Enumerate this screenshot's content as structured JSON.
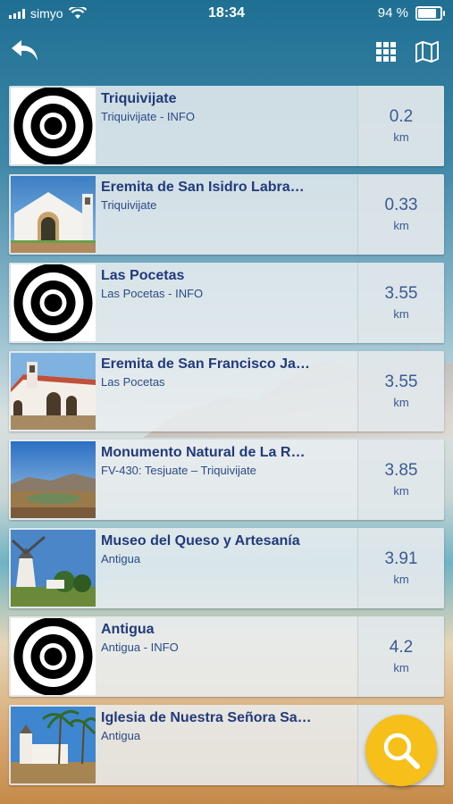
{
  "status": {
    "carrier": "simyo",
    "time": "18:34",
    "battery": "94 %",
    "battery_level": 0.94
  },
  "toolbar": {
    "back_icon": "back-arrow-icon",
    "grid_icon": "grid-icon",
    "map_icon": "map-icon"
  },
  "items": [
    {
      "title": "Triquivijate",
      "subtitle": "Triquivijate - INFO",
      "distance": "0.2",
      "unit": "km",
      "thumb": "target-icon"
    },
    {
      "title": "Eremita de San Isidro Labra…",
      "subtitle": "Triquivijate",
      "distance": "0.33",
      "unit": "km",
      "thumb": "chapel-photo"
    },
    {
      "title": "Las Pocetas",
      "subtitle": "Las Pocetas - INFO",
      "distance": "3.55",
      "unit": "km",
      "thumb": "target-icon"
    },
    {
      "title": "Eremita de San Francisco Ja…",
      "subtitle": "Las Pocetas",
      "distance": "3.55",
      "unit": "km",
      "thumb": "chapel-photo"
    },
    {
      "title": "Monumento Natural de La R…",
      "subtitle": "FV-430: Tesjuate – Triquivijate",
      "distance": "3.85",
      "unit": "km",
      "thumb": "landscape-photo"
    },
    {
      "title": "Museo del Queso y Artesanía",
      "subtitle": "Antigua",
      "distance": "3.91",
      "unit": "km",
      "thumb": "windmill-photo"
    },
    {
      "title": "Antigua",
      "subtitle": "Antigua - INFO",
      "distance": "4.2",
      "unit": "km",
      "thumb": "target-icon"
    },
    {
      "title": "Iglesia de Nuestra Señora Sa…",
      "subtitle": "Antigua",
      "distance": "",
      "unit": "",
      "thumb": "church-photo"
    }
  ],
  "search_fab": {
    "icon": "search-icon",
    "color": "#f6bf1a"
  },
  "colors": {
    "title": "#223a7a",
    "subtitle": "#2b4a86",
    "distance": "#3a5a92"
  }
}
